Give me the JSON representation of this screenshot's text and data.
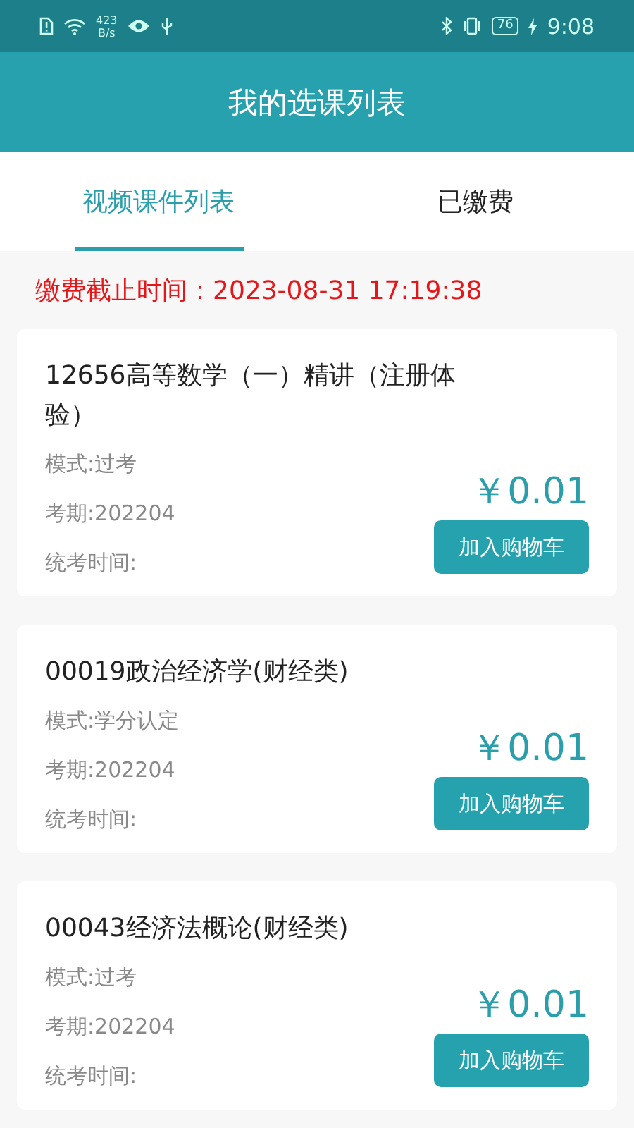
{
  "status_bar": {
    "speed_value": "423",
    "speed_unit": "B/s",
    "battery": "76",
    "time": "9:08"
  },
  "header": {
    "title": "我的选课列表"
  },
  "tabs": [
    {
      "label": "视频课件列表",
      "selected": true
    },
    {
      "label": "已缴费",
      "selected": false
    }
  ],
  "deadline": "缴费截止时间：2023-08-31 17:19:38",
  "courses": [
    {
      "title": "12656高等数学（一）精讲（注册体验）",
      "mode": "模式:过考",
      "term": "考期:202204",
      "exam_time": "统考时间:",
      "price": "￥0.01",
      "button": "加入购物车"
    },
    {
      "title": "00019政治经济学(财经类)",
      "mode": "模式:学分认定",
      "term": "考期:202204",
      "exam_time": "统考时间:",
      "price": "￥0.01",
      "button": "加入购物车"
    },
    {
      "title": "00043经济法概论(财经类)",
      "mode": "模式:过考",
      "term": "考期:202204",
      "exam_time": "统考时间:",
      "price": "￥0.01",
      "button": "加入购物车"
    }
  ]
}
